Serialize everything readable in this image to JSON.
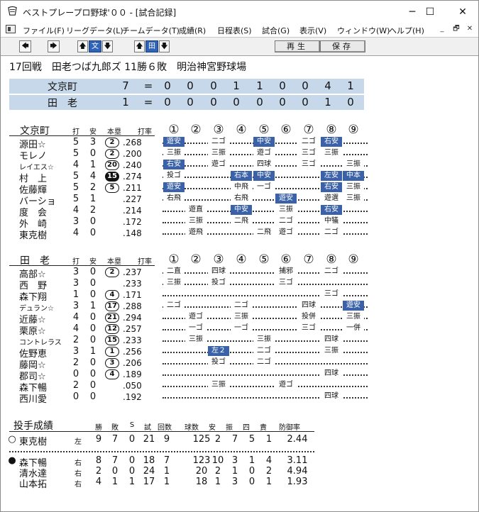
{
  "window": {
    "title": "ベストプレープロ野球'００ - [試合記録]",
    "minimize": "─",
    "maximize": "☐",
    "close": "✕"
  },
  "menu": [
    "ファイル(F)",
    "リーグデータ(L)",
    "チームデータ(T)",
    "成績(R)",
    "日程表(S)",
    "試合(G)",
    "表示(V)",
    "ウィンドウ(W)",
    "ヘルプ(H)"
  ],
  "mdi": {
    "minimize": "_",
    "restore": "🗗",
    "close": "✕"
  },
  "toolbar": {
    "team1": "文",
    "team2": "田",
    "play_label": "再生",
    "save_label": "保存"
  },
  "game_info": "17回戦　田老つば九郎ズ 11勝６敗　明治神宮野球場",
  "scoreboard": [
    {
      "team": "文京町",
      "total": "7",
      "eq": "=",
      "innings": [
        "0",
        "0",
        "0",
        "1",
        "1",
        "0",
        "0",
        "4",
        "1"
      ]
    },
    {
      "team": "田　老",
      "total": "1",
      "eq": "=",
      "innings": [
        "0",
        "0",
        "0",
        "0",
        "0",
        "0",
        "0",
        "1",
        "0"
      ]
    }
  ],
  "batting_headers": {
    "ab": "打",
    "h": "安",
    "hr": "本塁",
    "avg": "打率"
  },
  "inning_headers": [
    "①",
    "②",
    "③",
    "④",
    "⑤",
    "⑥",
    "⑦",
    "⑧",
    "⑨"
  ],
  "teams": [
    {
      "name": "文京町",
      "batters": [
        {
          "name": "源田☆",
          "ab": "5",
          "h": "3",
          "hr": "2",
          "hr_style": "outline",
          "avg": ".268",
          "results": [
            {
              "i": 1,
              "t": "遊安",
              "hl": true
            },
            {
              "i": 3,
              "t": "二ゴ"
            },
            {
              "i": 5,
              "t": "中安",
              "hl": true
            },
            {
              "i": 7,
              "t": "二ゴ"
            },
            {
              "i": 8,
              "t": "右安",
              "hl": true
            }
          ]
        },
        {
          "name": "モレノ",
          "ab": "5",
          "h": "0",
          "hr": "2",
          "hr_style": "outline",
          "avg": ".200",
          "results": [
            {
              "i": 1,
              "t": "三振"
            },
            {
              "i": 3,
              "t": "三振"
            },
            {
              "i": 5,
              "t": "遊ゴ"
            },
            {
              "i": 7,
              "t": "三ゴ"
            },
            {
              "i": 8,
              "t": "三振"
            }
          ]
        },
        {
          "name": "レイエス☆",
          "small": true,
          "ab": "4",
          "h": "1",
          "hr": "20",
          "hr_style": "outline",
          "avg": ".240",
          "results": [
            {
              "i": 1,
              "t": "右安",
              "hl": true
            },
            {
              "i": 3,
              "t": "遊ゴ"
            },
            {
              "i": 5,
              "t": "四球"
            },
            {
              "i": 7,
              "t": "三ゴ"
            },
            {
              "i": 9,
              "t": "三振"
            }
          ]
        },
        {
          "name": "村　上",
          "ab": "5",
          "h": "4",
          "hr": "15",
          "hr_style": "filled",
          "avg": ".274",
          "results": [
            {
              "i": 1,
              "t": "投ゴ"
            },
            {
              "i": 4,
              "t": "右本",
              "hl": true
            },
            {
              "i": 5,
              "t": "中安",
              "hl": true
            },
            {
              "i": 8,
              "t": "左安",
              "hl": true
            },
            {
              "i": 9,
              "t": "中本",
              "hl": true
            }
          ]
        },
        {
          "name": "佐藤輝",
          "ab": "5",
          "h": "2",
          "hr": "5",
          "hr_style": "outline",
          "avg": ".211",
          "results": [
            {
              "i": 1,
              "t": "遊安",
              "hl": true
            },
            {
              "i": 4,
              "t": "中飛"
            },
            {
              "i": 5,
              "t": "一ゴ"
            },
            {
              "i": 8,
              "t": "右安",
              "hl": true
            },
            {
              "i": 9,
              "t": "三振"
            }
          ]
        },
        {
          "name": "バーショ",
          "ab": "5",
          "h": "1",
          "hr": "",
          "hr_style": "",
          "avg": ".227",
          "results": [
            {
              "i": 1,
              "t": "右飛"
            },
            {
              "i": 4,
              "t": "右飛"
            },
            {
              "i": 6,
              "t": "遊安",
              "hl": true
            },
            {
              "i": 8,
              "t": "遊選"
            },
            {
              "i": 9,
              "t": "三振"
            }
          ]
        },
        {
          "name": "度　会",
          "ab": "4",
          "h": "2",
          "hr": "",
          "hr_style": "",
          "avg": ".214",
          "results": [
            {
              "i": 2,
              "t": "遊直"
            },
            {
              "i": 4,
              "t": "中安",
              "hl": true
            },
            {
              "i": 6,
              "t": "三振"
            },
            {
              "i": 8,
              "t": "右安",
              "hl": true
            }
          ]
        },
        {
          "name": "外　崎",
          "ab": "3",
          "h": "0",
          "hr": "",
          "hr_style": "",
          "avg": ".172",
          "results": [
            {
              "i": 2,
              "t": "三振"
            },
            {
              "i": 4,
              "t": "二飛"
            },
            {
              "i": 6,
              "t": "二ゴ"
            },
            {
              "i": 8,
              "t": "中犠"
            }
          ]
        },
        {
          "name": "東克樹",
          "ab": "4",
          "h": "0",
          "hr": "",
          "hr_style": "",
          "avg": ".148",
          "results": [
            {
              "i": 2,
              "t": "遊飛"
            },
            {
              "i": 5,
              "t": "二飛"
            },
            {
              "i": 6,
              "t": "遊ゴ"
            },
            {
              "i": 8,
              "t": "二ゴ"
            }
          ]
        }
      ]
    },
    {
      "name": "田　老",
      "batters": [
        {
          "name": "高部☆",
          "ab": "3",
          "h": "0",
          "hr": "2",
          "hr_style": "outline",
          "avg": ".237",
          "results": [
            {
              "i": 1,
              "t": "二直"
            },
            {
              "i": 3,
              "t": "四球"
            },
            {
              "i": 6,
              "t": "捕邪"
            },
            {
              "i": 8,
              "t": "二ゴ"
            }
          ]
        },
        {
          "name": "西　野",
          "ab": "3",
          "h": "0",
          "hr": "",
          "hr_style": "",
          "avg": ".233",
          "results": [
            {
              "i": 1,
              "t": "三振"
            },
            {
              "i": 3,
              "t": "投ゴ"
            },
            {
              "i": 6,
              "t": "三ゴ"
            }
          ]
        },
        {
          "name": "森下翔",
          "ab": "1",
          "h": "0",
          "hr": "4",
          "hr_style": "outline",
          "avg": ".171",
          "results": [
            {
              "i": 8,
              "t": "三ゴ"
            }
          ]
        },
        {
          "name": "デュラン☆",
          "small": true,
          "ab": "3",
          "h": "1",
          "hr": "17",
          "hr_style": "outline",
          "avg": ".288",
          "results": [
            {
              "i": 1,
              "t": "二ゴ"
            },
            {
              "i": 4,
              "t": "二ゴ"
            },
            {
              "i": 7,
              "t": "四球"
            },
            {
              "i": 9,
              "t": "遊安",
              "hl": true
            }
          ]
        },
        {
          "name": "近藤☆",
          "ab": "4",
          "h": "0",
          "hr": "21",
          "hr_style": "outline",
          "avg": ".294",
          "results": [
            {
              "i": 2,
              "t": "遊ゴ"
            },
            {
              "i": 4,
              "t": "三振"
            },
            {
              "i": 7,
              "t": "投併"
            },
            {
              "i": 9,
              "t": "三振"
            }
          ]
        },
        {
          "name": "栗原☆",
          "ab": "4",
          "h": "0",
          "hr": "12",
          "hr_style": "outline",
          "avg": ".257",
          "results": [
            {
              "i": 2,
              "t": "一ゴ"
            },
            {
              "i": 4,
              "t": "一ゴ"
            },
            {
              "i": 7,
              "t": "三ゴ"
            },
            {
              "i": 9,
              "t": "一併"
            }
          ]
        },
        {
          "name": "コントレラス",
          "small": true,
          "ab": "2",
          "h": "0",
          "hr": "15",
          "hr_style": "outline",
          "avg": ".233",
          "results": [
            {
              "i": 2,
              "t": "三振"
            },
            {
              "i": 5,
              "t": "三振"
            },
            {
              "i": 8,
              "t": "四球"
            }
          ]
        },
        {
          "name": "佐野恵",
          "ab": "3",
          "h": "1",
          "hr": "1",
          "hr_style": "outline",
          "avg": ".256",
          "results": [
            {
              "i": 3,
              "t": "左２",
              "hl": true
            },
            {
              "i": 5,
              "t": "二ゴ"
            },
            {
              "i": 8,
              "t": "三振"
            }
          ]
        },
        {
          "name": "藤岡☆",
          "ab": "2",
          "h": "0",
          "hr": "3",
          "hr_style": "outline",
          "avg": ".206",
          "results": [
            {
              "i": 3,
              "t": "投ゴ"
            },
            {
              "i": 5,
              "t": "二ゴ"
            }
          ]
        },
        {
          "name": "郡司☆",
          "ab": "0",
          "h": "0",
          "hr": "4",
          "hr_style": "outline",
          "avg": ".189",
          "results": [
            {
              "i": 8,
              "t": "四球"
            }
          ]
        },
        {
          "name": "森下暢",
          "ab": "2",
          "h": "0",
          "hr": "",
          "hr_style": "",
          "avg": ".050",
          "results": [
            {
              "i": 3,
              "t": "三振"
            },
            {
              "i": 6,
              "t": "遊ゴ"
            }
          ]
        },
        {
          "name": "西川愛",
          "ab": "0",
          "h": "0",
          "hr": "",
          "hr_style": "",
          "avg": ".192",
          "results": [
            {
              "i": 8,
              "t": "四球"
            }
          ]
        }
      ]
    }
  ],
  "pitching": {
    "title": "投手成績",
    "headers": [
      "勝",
      "敗",
      "S",
      "試",
      "回数",
      "球数",
      "安",
      "振",
      "四",
      "責",
      "防御率"
    ],
    "groups": [
      [
        {
          "mark": "○",
          "name": "東克樹",
          "hand": "左",
          "w": "9",
          "l": "7",
          "s": "0",
          "g": "21",
          "ip": "9",
          "np": "125",
          "h": "2",
          "k": "7",
          "bb": "5",
          "er": "1",
          "era": "2.44"
        }
      ],
      [
        {
          "mark": "●",
          "name": "森下暢",
          "hand": "右",
          "w": "8",
          "l": "7",
          "s": "0",
          "g": "18",
          "ip": "7",
          "np": "123",
          "h": "10",
          "k": "3",
          "bb": "1",
          "er": "4",
          "era": "3.11"
        },
        {
          "mark": "",
          "name": "清水達",
          "hand": "右",
          "w": "2",
          "l": "0",
          "s": "0",
          "g": "24",
          "ip": "1",
          "np": "20",
          "h": "2",
          "k": "1",
          "bb": "0",
          "er": "2",
          "era": "4.94"
        },
        {
          "mark": "",
          "name": "山本拓",
          "hand": "右",
          "w": "4",
          "l": "1",
          "s": "1",
          "g": "17",
          "ip": "1",
          "np": "18",
          "h": "1",
          "k": "3",
          "bb": "0",
          "er": "1",
          "era": "1.93"
        }
      ]
    ]
  }
}
